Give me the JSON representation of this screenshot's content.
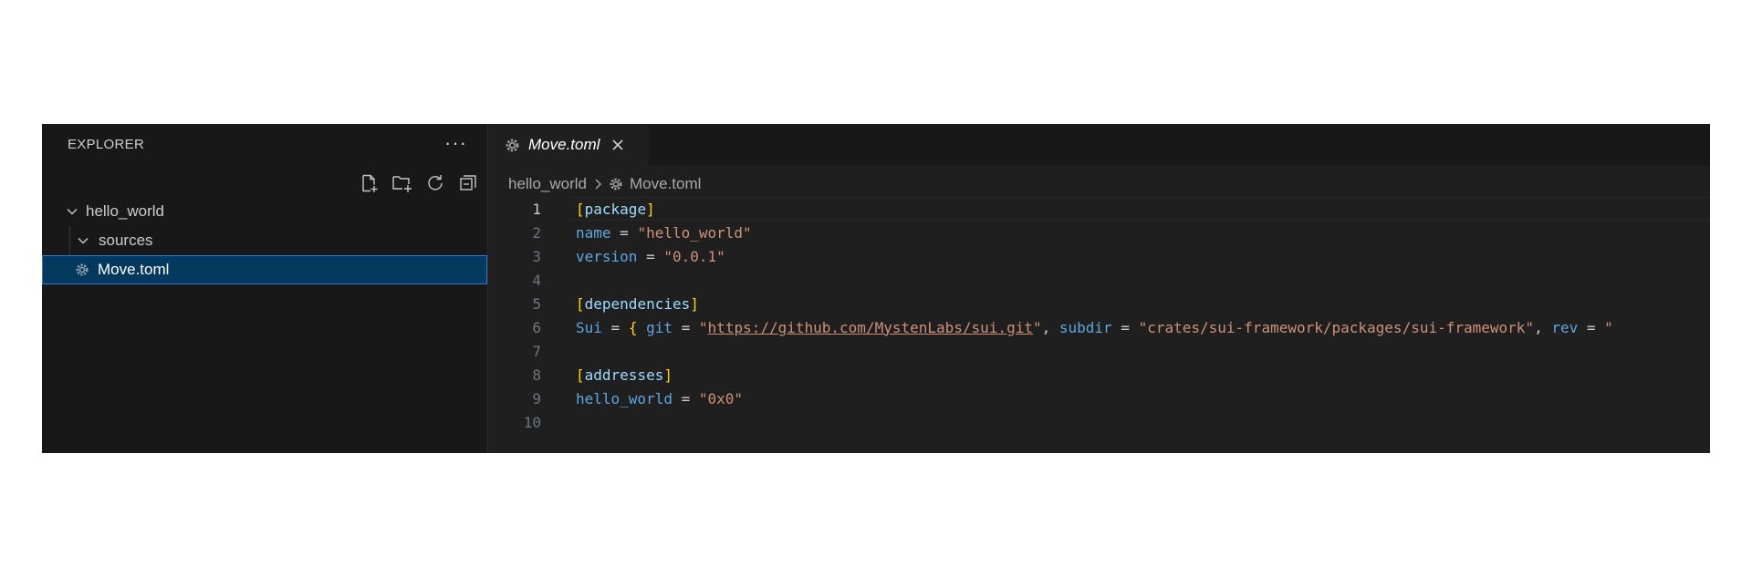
{
  "sidebar": {
    "title": "EXPLORER",
    "more": "···",
    "actions": [
      "new-file-icon",
      "new-folder-icon",
      "refresh-icon",
      "collapse-all-icon"
    ],
    "tree": {
      "root": "hello_world",
      "folder": "sources",
      "file": "Move.toml"
    }
  },
  "editor": {
    "tab": {
      "label": "Move.toml",
      "close": "×"
    },
    "breadcrumb": {
      "folder": "hello_world",
      "file": "Move.toml"
    },
    "lines": {
      "n1": "1",
      "n2": "2",
      "n3": "3",
      "n4": "4",
      "n5": "5",
      "n6": "6",
      "n7": "7",
      "n8": "8",
      "n9": "9",
      "n10": "10"
    },
    "code": {
      "l1_section": "package",
      "l2_key": "name",
      "l2_value": "\"hello_world\"",
      "l3_key": "version",
      "l3_value": "\"0.0.1\"",
      "l5_section": "dependencies",
      "l6_key": "Sui",
      "l6_k_git": "git",
      "l6_quote_open": "\"",
      "l6_url": "https://github.com/MystenLabs/sui.git",
      "l6_quote_close": "\"",
      "l6_k_subdir": "subdir",
      "l6_v_subdir": "\"crates/sui-framework/packages/sui-framework\"",
      "l6_k_rev": "rev",
      "l6_v_rev": "\"",
      "l8_section": "addresses",
      "l9_key": "hello_world",
      "l9_value": "\"0x0\""
    }
  },
  "colors": {
    "bracket": "#ffd700",
    "key": "#5ca7e0",
    "string": "#ce9178",
    "selection": "#04395e"
  }
}
